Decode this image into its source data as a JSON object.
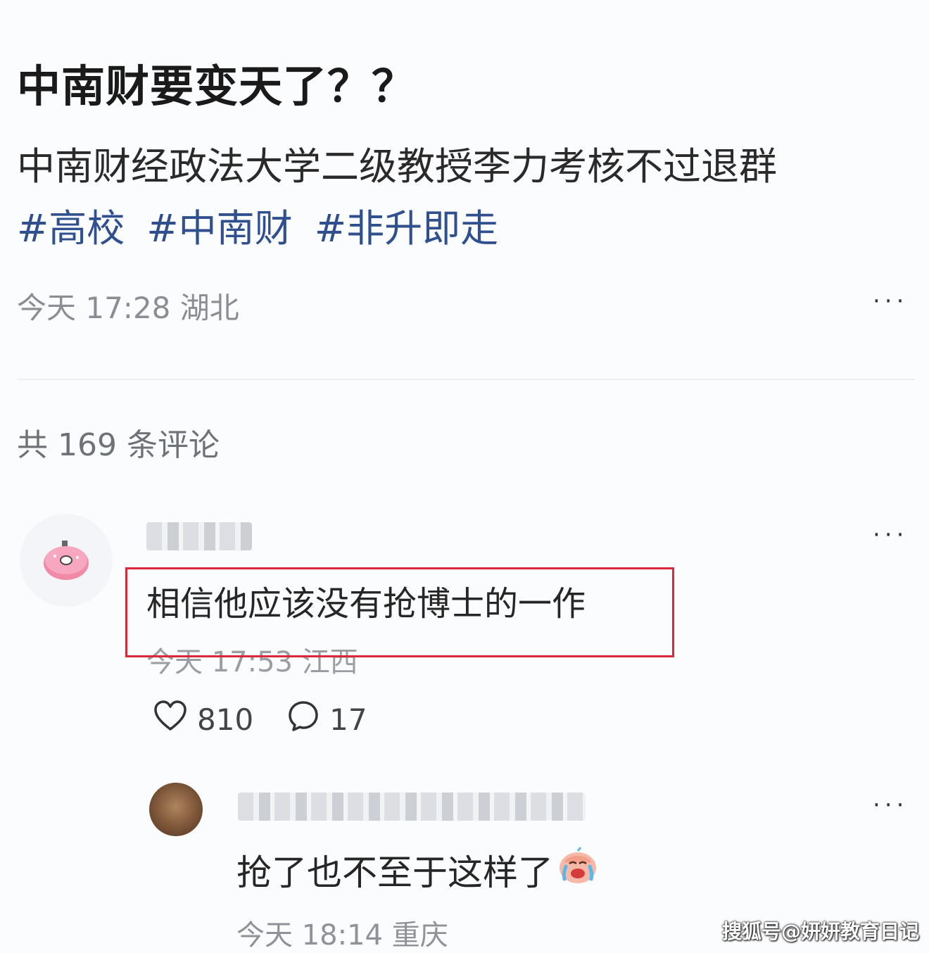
{
  "post": {
    "title": "中南财要变天了？？",
    "body": "中南财经政法大学二级教授李力考核不过退群",
    "tags": [
      "#高校",
      "#中南财",
      "#非升即走"
    ],
    "meta": "今天 17:28 湖北",
    "more": "···"
  },
  "comments_header": {
    "count_label": "共 169 条评论"
  },
  "comment": {
    "text": "相信他应该没有抢博士的一作",
    "meta": "今天 17:53 江西",
    "likes": "810",
    "replies": "17",
    "more": "···",
    "highlight_color": "#d8283a"
  },
  "reply": {
    "text": "抢了也不至于这样了",
    "meta": "今天 18:14 重庆",
    "more": "···"
  },
  "watermark": "搜狐号@妍妍教育日记"
}
